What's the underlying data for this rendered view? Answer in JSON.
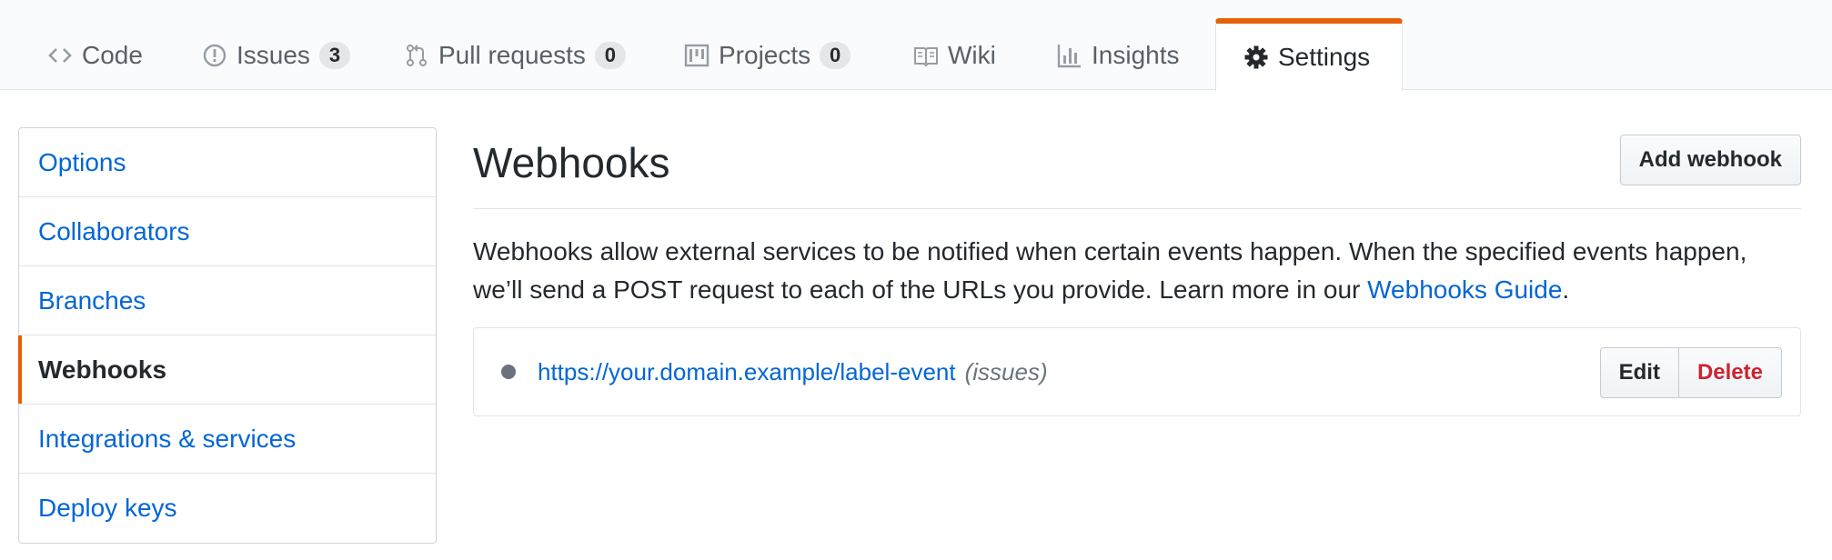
{
  "reponav": {
    "tabs": [
      {
        "label": "Code",
        "icon": "code-icon"
      },
      {
        "label": "Issues",
        "icon": "issue-opened-icon",
        "count": "3"
      },
      {
        "label": "Pull requests",
        "icon": "git-pull-request-icon",
        "count": "0"
      },
      {
        "label": "Projects",
        "icon": "project-icon",
        "count": "0"
      },
      {
        "label": "Wiki",
        "icon": "book-icon"
      },
      {
        "label": "Insights",
        "icon": "graph-icon"
      },
      {
        "label": "Settings",
        "icon": "gear-icon",
        "selected": true
      }
    ],
    "accent_color": "#e36209"
  },
  "sidebar": {
    "items": [
      {
        "label": "Options"
      },
      {
        "label": "Collaborators"
      },
      {
        "label": "Branches"
      },
      {
        "label": "Webhooks",
        "selected": true
      },
      {
        "label": "Integrations & services"
      },
      {
        "label": "Deploy keys"
      }
    ]
  },
  "main": {
    "title": "Webhooks",
    "add_button_label": "Add webhook",
    "description_prefix": "Webhooks allow external services to be notified when certain events happen. When the specified events happen, we’ll send a POST request to each of the URLs you provide. Learn more in our ",
    "description_link": "Webhooks Guide",
    "description_suffix": ".",
    "hooks": [
      {
        "url": "https://your.domain.example/label-event",
        "events": "(issues)",
        "edit_label": "Edit",
        "delete_label": "Delete"
      }
    ]
  },
  "colors": {
    "link": "#0366d6",
    "danger": "#cb2431",
    "muted": "#586069"
  }
}
